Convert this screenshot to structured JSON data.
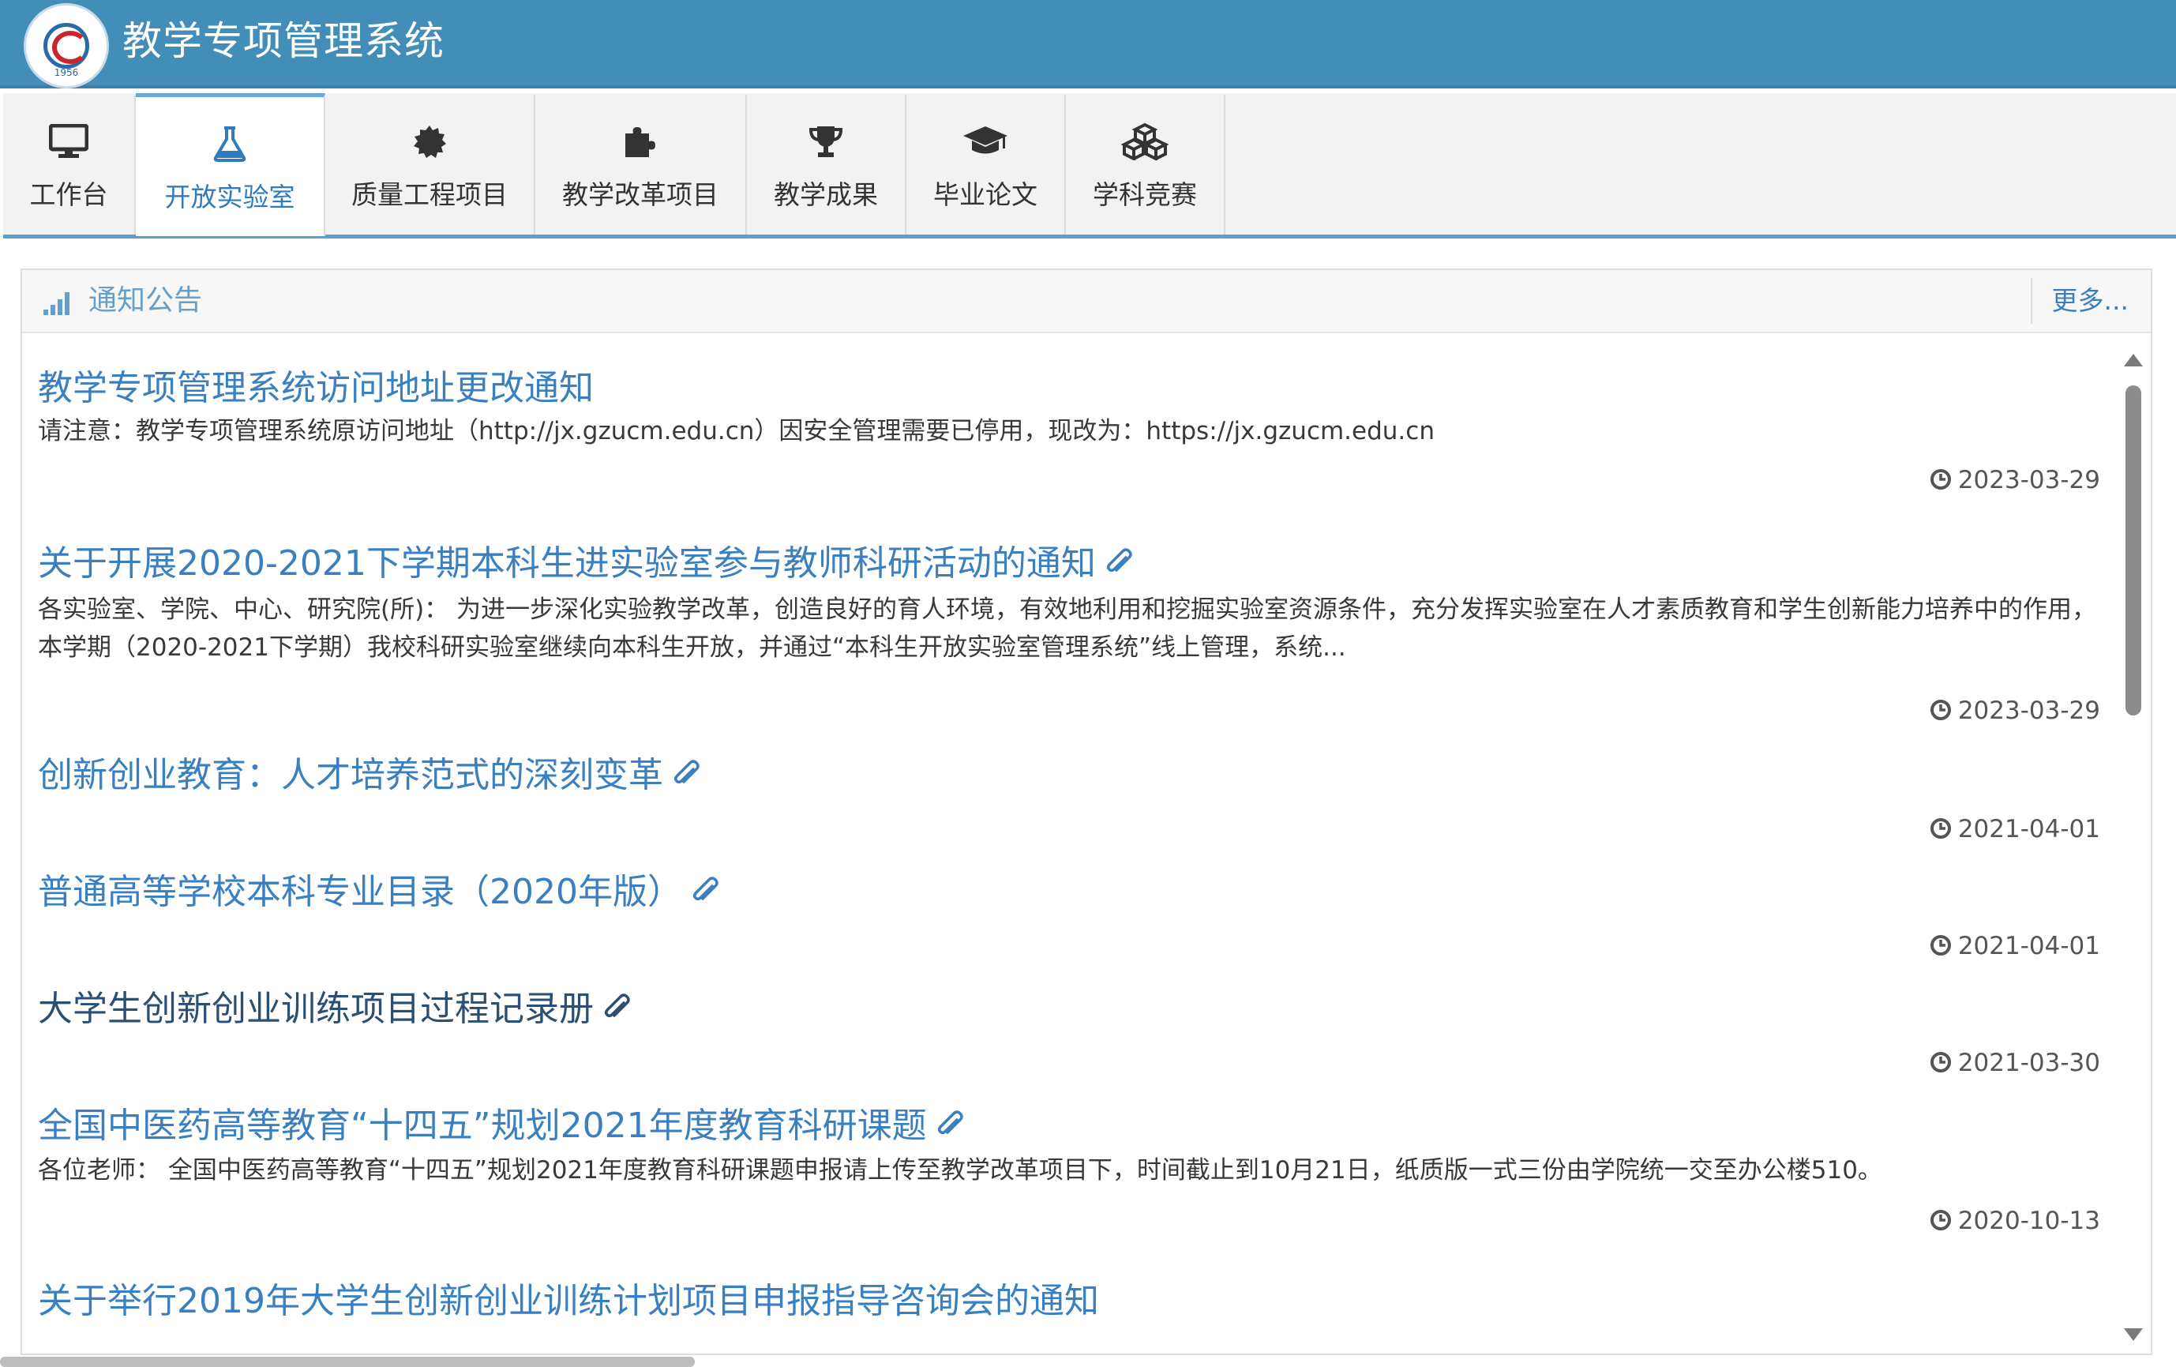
{
  "app": {
    "title": "教学专项管理系统",
    "logo_year": "1956",
    "brand_color": "#438eb9"
  },
  "tabs": [
    {
      "label": "工作台",
      "icon": "monitor-icon",
      "active": false
    },
    {
      "label": "开放实验室",
      "icon": "flask-icon",
      "active": true
    },
    {
      "label": "质量工程项目",
      "icon": "gear-badge-icon",
      "active": false
    },
    {
      "label": "教学改革项目",
      "icon": "puzzle-icon",
      "active": false
    },
    {
      "label": "教学成果",
      "icon": "trophy-icon",
      "active": false
    },
    {
      "label": "毕业论文",
      "icon": "graduation-cap-icon",
      "active": false
    },
    {
      "label": "学科竞赛",
      "icon": "cubes-icon",
      "active": false
    }
  ],
  "panel": {
    "title": "通知公告",
    "icon": "signal-icon",
    "more_label": "更多..."
  },
  "notices": [
    {
      "title": "教学专项管理系统访问地址更改通知",
      "attachment": false,
      "desc": "请注意：教学专项管理系统原访问地址（http://jx.gzucm.edu.cn）因安全管理需要已停用，现改为：https://jx.gzucm.edu.cn",
      "date": "2023-03-29"
    },
    {
      "title": "关于开展2020-2021下学期本科生进实验室参与教师科研活动的通知",
      "attachment": true,
      "desc": "各实验室、学院、中心、研究院(所)：        为进一步深化实验教学改革，创造良好的育人环境，有效地利用和挖掘实验室资源条件，充分发挥实验室在人才素质教育和学生创新能力培养中的作用，本学期（2020-2021下学期）我校科研实验室继续向本科生开放，并通过“本科生开放实验室管理系统”线上管理，系统...",
      "date": "2023-03-29"
    },
    {
      "title": "创新创业教育：人才培养范式的深刻变革",
      "attachment": true,
      "desc": "",
      "date": "2021-04-01"
    },
    {
      "title": "普通高等学校本科专业目录（2020年版）",
      "attachment": true,
      "desc": "",
      "date": "2021-04-01"
    },
    {
      "title": "大学生创新创业训练项目过程记录册",
      "attachment": true,
      "desc": "",
      "date": "2021-03-30"
    },
    {
      "title": "全国中医药高等教育“十四五”规划2021年度教育科研课题",
      "attachment": true,
      "desc": "各位老师：       全国中医药高等教育“十四五”规划2021年度教育科研课题申报请上传至教学改革项目下，时间截止到10月21日，纸质版一式三份由学院统一交至办公楼510。",
      "date": "2020-10-13"
    },
    {
      "title": "关于举行2019年大学生创新创业训练计划项目申报指导咨询会的通知",
      "attachment": false,
      "desc": "",
      "date": ""
    }
  ]
}
